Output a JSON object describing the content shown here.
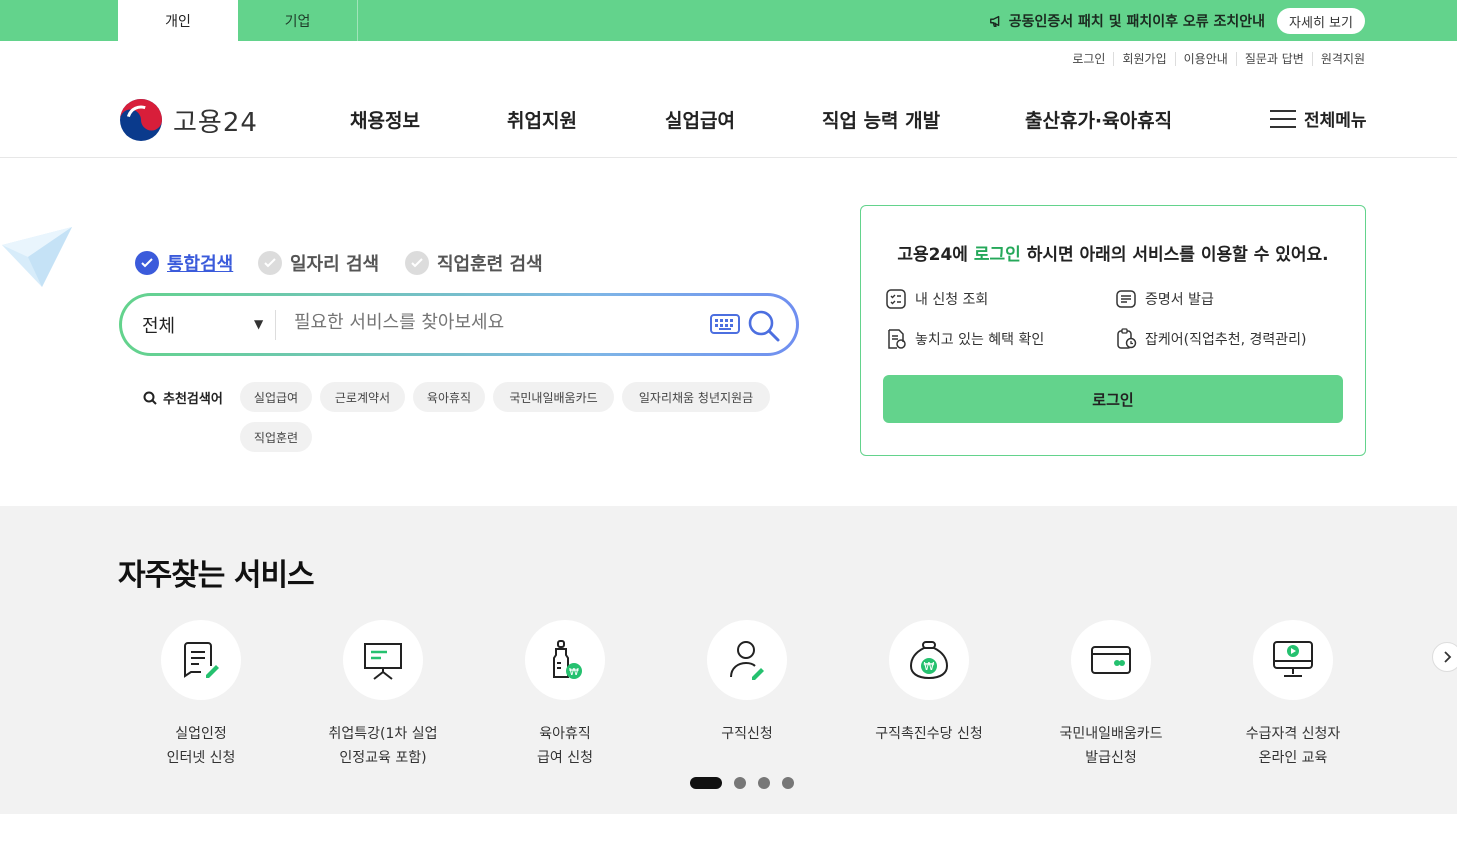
{
  "topbar": {
    "tabs": [
      "개인",
      "기업"
    ],
    "notice": "공동인증서 패치 및 패치이후 오류 조치안내",
    "detail_button": "자세히 보기"
  },
  "util_links": [
    "로그인",
    "회원가입",
    "이용안내",
    "질문과 답변",
    "원격지원"
  ],
  "header": {
    "logo_text": "고용24",
    "nav": [
      "채용정보",
      "취업지원",
      "실업급여",
      "직업 능력 개발",
      "출산휴가·육아휴직"
    ],
    "all_menu": "전체메뉴"
  },
  "search": {
    "tabs": [
      "통합검색",
      "일자리 검색",
      "직업훈련 검색"
    ],
    "category": "전체",
    "placeholder": "필요한 서비스를 찾아보세요",
    "recommend_label": "추천검색어",
    "keywords": [
      "실업급여",
      "근로계약서",
      "육아휴직",
      "국민내일배움카드",
      "일자리채움 청년지원금",
      "직업훈련"
    ]
  },
  "login_box": {
    "title_prefix": "고용24에 ",
    "title_highlight": "로그인",
    "title_suffix": " 하시면 아래의 서비스를 이용할 수 있어요.",
    "items": [
      "내 신청 조회",
      "증명서 발급",
      "놓치고 있는 혜택 확인",
      "잡케어(직업추천, 경력관리)"
    ],
    "button": "로그인"
  },
  "services": {
    "title": "자주찾는 서비스",
    "items": [
      {
        "label": "실업인정\n인터넷 신청",
        "icon": "document-pen-icon"
      },
      {
        "label": "취업특강(1차 실업\n인정교육 포함)",
        "icon": "presentation-board-icon"
      },
      {
        "label": "육아휴직\n급여 신청",
        "icon": "baby-bottle-won-icon"
      },
      {
        "label": "구직신청",
        "icon": "person-pen-icon"
      },
      {
        "label": "구직촉진수당 신청",
        "icon": "money-bag-won-icon"
      },
      {
        "label": "국민내일배움카드\n발급신청",
        "icon": "card-icon"
      },
      {
        "label": "수급자격 신청자\n온라인 교육",
        "icon": "monitor-play-icon"
      }
    ],
    "pagination": {
      "current": 1,
      "total": 4
    }
  },
  "colors": {
    "brand_green": "#63d38c",
    "accent_blue": "#3b5bdb"
  }
}
